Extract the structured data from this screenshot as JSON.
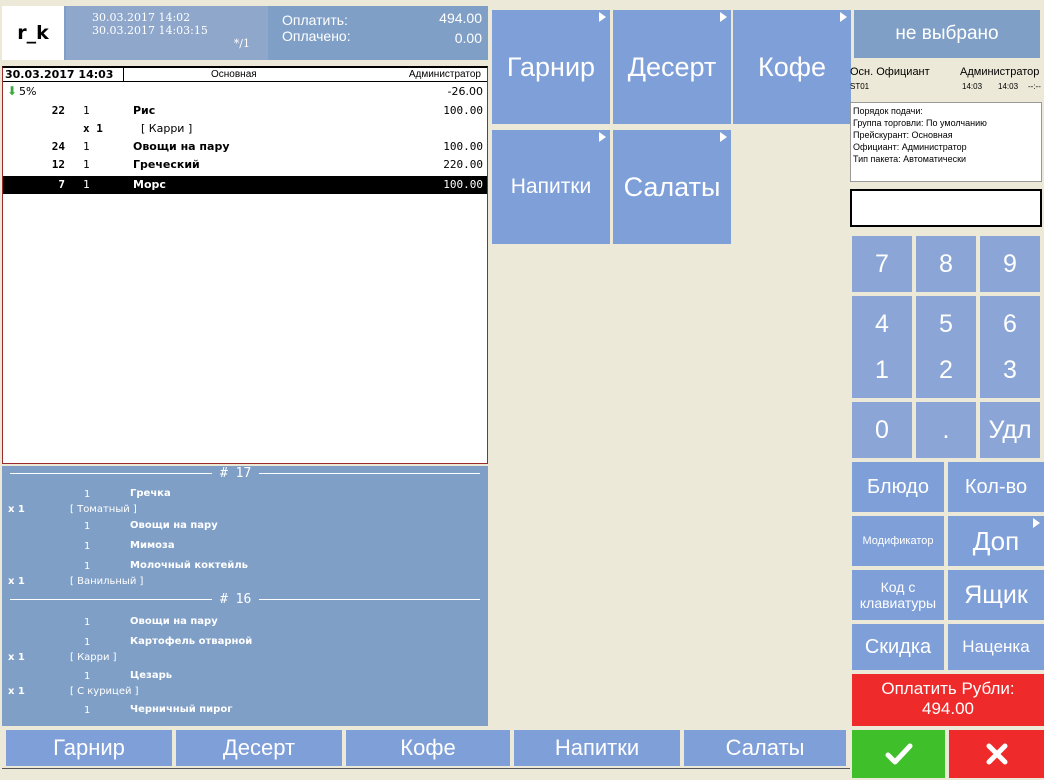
{
  "header": {
    "logo": "r_k",
    "time_open": "30.03.2017 14:02",
    "time_now": "30.03.2017 14:03:15",
    "slot": "*/1",
    "pay_label": "Оплатить:",
    "pay_value": "494.00",
    "paid_label": "Оплачено:",
    "paid_value": "0.00"
  },
  "order": {
    "date": "30.03.2017 14:03",
    "menu": "Основная",
    "user": "Администратор",
    "discount_pct": "5%",
    "discount_value": "-26.00",
    "rows": [
      {
        "seat": "22",
        "qty": "1",
        "name": "Рис",
        "price": "100.00"
      },
      {
        "mod_x": "x 1",
        "mod": "[ Карри ]"
      },
      {
        "seat": "24",
        "qty": "1",
        "name": "Овощи на пару",
        "price": "100.00"
      },
      {
        "seat": "12",
        "qty": "1",
        "name": "Греческий",
        "price": "220.00"
      },
      {
        "seat": "7",
        "qty": "1",
        "name": "Морс",
        "price": "100.00"
      }
    ]
  },
  "history": {
    "order1_num": "# 17",
    "order2_num": "# 16",
    "r1": {
      "qty": "1",
      "name": "Гречка"
    },
    "r2": {
      "x": "x 1",
      "mod": "[ Томатный ]"
    },
    "r3": {
      "qty": "1",
      "name": "Овощи на пару"
    },
    "r4": {
      "qty": "1",
      "name": "Мимоза"
    },
    "r5": {
      "qty": "1",
      "name": "Молочный коктейль"
    },
    "r6": {
      "x": "x 1",
      "mod": "[ Ванильный ]"
    },
    "r7": {
      "qty": "1",
      "name": "Овощи на пару"
    },
    "r8": {
      "qty": "1",
      "name": "Картофель отварной"
    },
    "r9": {
      "x": "x 1",
      "mod": "[ Карри ]"
    },
    "r10": {
      "qty": "1",
      "name": "Цезарь"
    },
    "r11": {
      "x": "x 1",
      "mod": "[ С курицей ]"
    },
    "r12": {
      "qty": "1",
      "name": "Черничный пирог"
    }
  },
  "categories": {
    "garnir": "Гарнир",
    "desert": "Десерт",
    "kofe": "Кофе",
    "napitki": "Напитки",
    "salaty": "Салаты"
  },
  "right": {
    "status": "не выбрано",
    "staff_label": "Осн. Официант",
    "staff_name": "Администратор",
    "station": "ST01",
    "time1": "14:03",
    "time2": "14:03",
    "time3": "--:--",
    "info": [
      "Порядок подачи:",
      "Группа торговли: По умолчанию",
      "Прейскурант: Основная",
      "Официант: Администратор",
      "Тип пакета: Автоматически"
    ]
  },
  "numpad": {
    "k7": "7",
    "k8": "8",
    "k9": "9",
    "k4": "4",
    "k5": "5",
    "k6": "6",
    "k1": "1",
    "k2": "2",
    "k3": "3",
    "k0": "0",
    "kdot": ".",
    "kdel": "Удл"
  },
  "actions": {
    "dish": "Блюдо",
    "qty": "Кол-во",
    "modifier": "Модификатор",
    "extra": "Доп",
    "keyboard_code": "Код с клавиатуры",
    "drawer": "Ящик",
    "discount": "Скидка",
    "markup": "Наценка",
    "pay_label": "Оплатить Рубли:",
    "pay_value": "494.00"
  },
  "bottom": {
    "garnir": "Гарнир",
    "desert": "Десерт",
    "kofe": "Кофе",
    "napitki": "Напитки",
    "salaty": "Салаты"
  },
  "icons": {
    "discount": "arrow-down-icon",
    "ok": "checkmark-icon",
    "cancel": "close-icon"
  },
  "colors": {
    "tile": "#7f9fd9",
    "panel": "#7f9fc6",
    "pay": "#ef2a2a",
    "ok": "#3fbf2a"
  }
}
